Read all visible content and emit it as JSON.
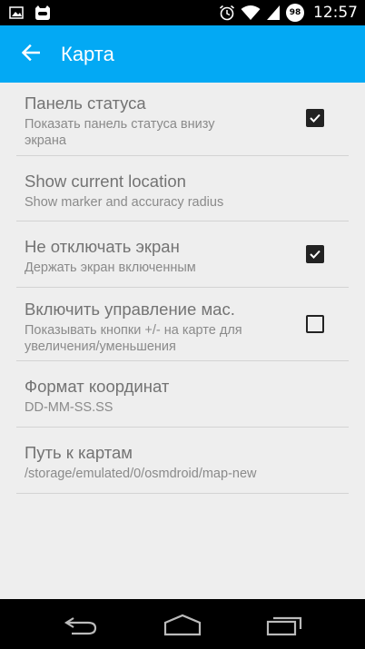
{
  "status_bar": {
    "time": "12:57",
    "battery_level": "98",
    "icons": [
      "image-icon",
      "cyanogen-icon",
      "alarm-icon",
      "wifi-icon",
      "signal-icon",
      "battery-icon"
    ]
  },
  "app_bar": {
    "title": "Карта",
    "back_icon": "arrow-back-icon",
    "color": "#03a9f4"
  },
  "settings": [
    {
      "title": "Панель статуса",
      "summary": "Показать панель статуса внизу экрана",
      "checkbox": true,
      "checked": true
    },
    {
      "title": "Show current location",
      "summary": "Show marker and accuracy radius",
      "checkbox": false
    },
    {
      "title": "Не отключать экран",
      "summary": "Держать экран включенным",
      "checkbox": true,
      "checked": true
    },
    {
      "title": "Включить управление мас.",
      "summary": "Показывать кнопки +/- на карте для увеличения/уменьшения",
      "checkbox": true,
      "checked": false
    },
    {
      "title": "Формат координат",
      "summary": "DD-MM-SS.SS",
      "checkbox": false
    },
    {
      "title": "Путь к картам",
      "summary": "/storage/emulated/0/osmdroid/map-new",
      "checkbox": false
    }
  ],
  "nav_bar": {
    "icons": [
      "back-nav-icon",
      "home-nav-icon",
      "recents-nav-icon"
    ]
  }
}
